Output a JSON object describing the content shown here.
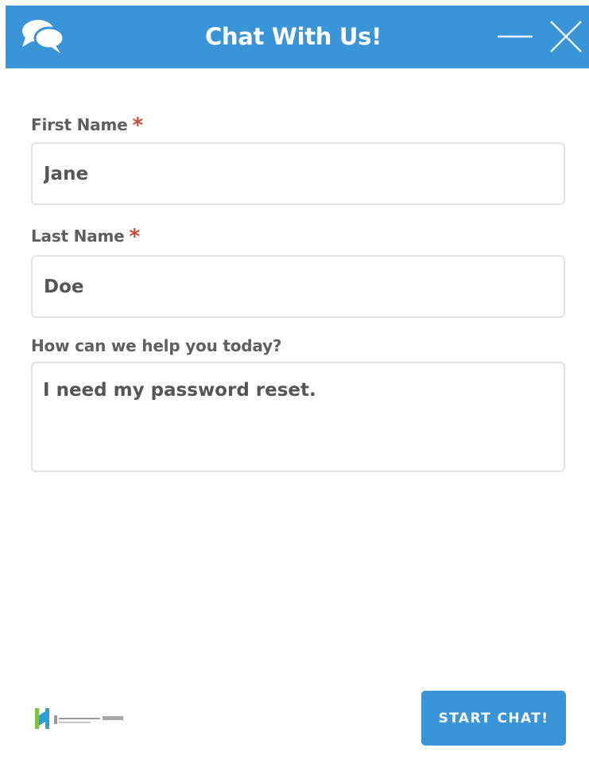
{
  "header": {
    "title": "Chat With Us!",
    "background_color": "#3a95d8",
    "chat_icon": "speech-bubbles-icon",
    "minimize_icon": "minimize-icon",
    "close_icon": "close-icon"
  },
  "form": {
    "first_name": {
      "label": "First Name",
      "required_marker": "*",
      "value": "Jane"
    },
    "last_name": {
      "label": "Last Name",
      "required_marker": "*",
      "value": "Doe"
    },
    "message": {
      "label": "How can we help you today?",
      "value": "I need my password reset."
    },
    "required_color": "#c84b34"
  },
  "footer": {
    "brand_logo": "heartsoft-logo",
    "start_button_label": "START CHAT!",
    "button_color": "#3a95d8"
  }
}
